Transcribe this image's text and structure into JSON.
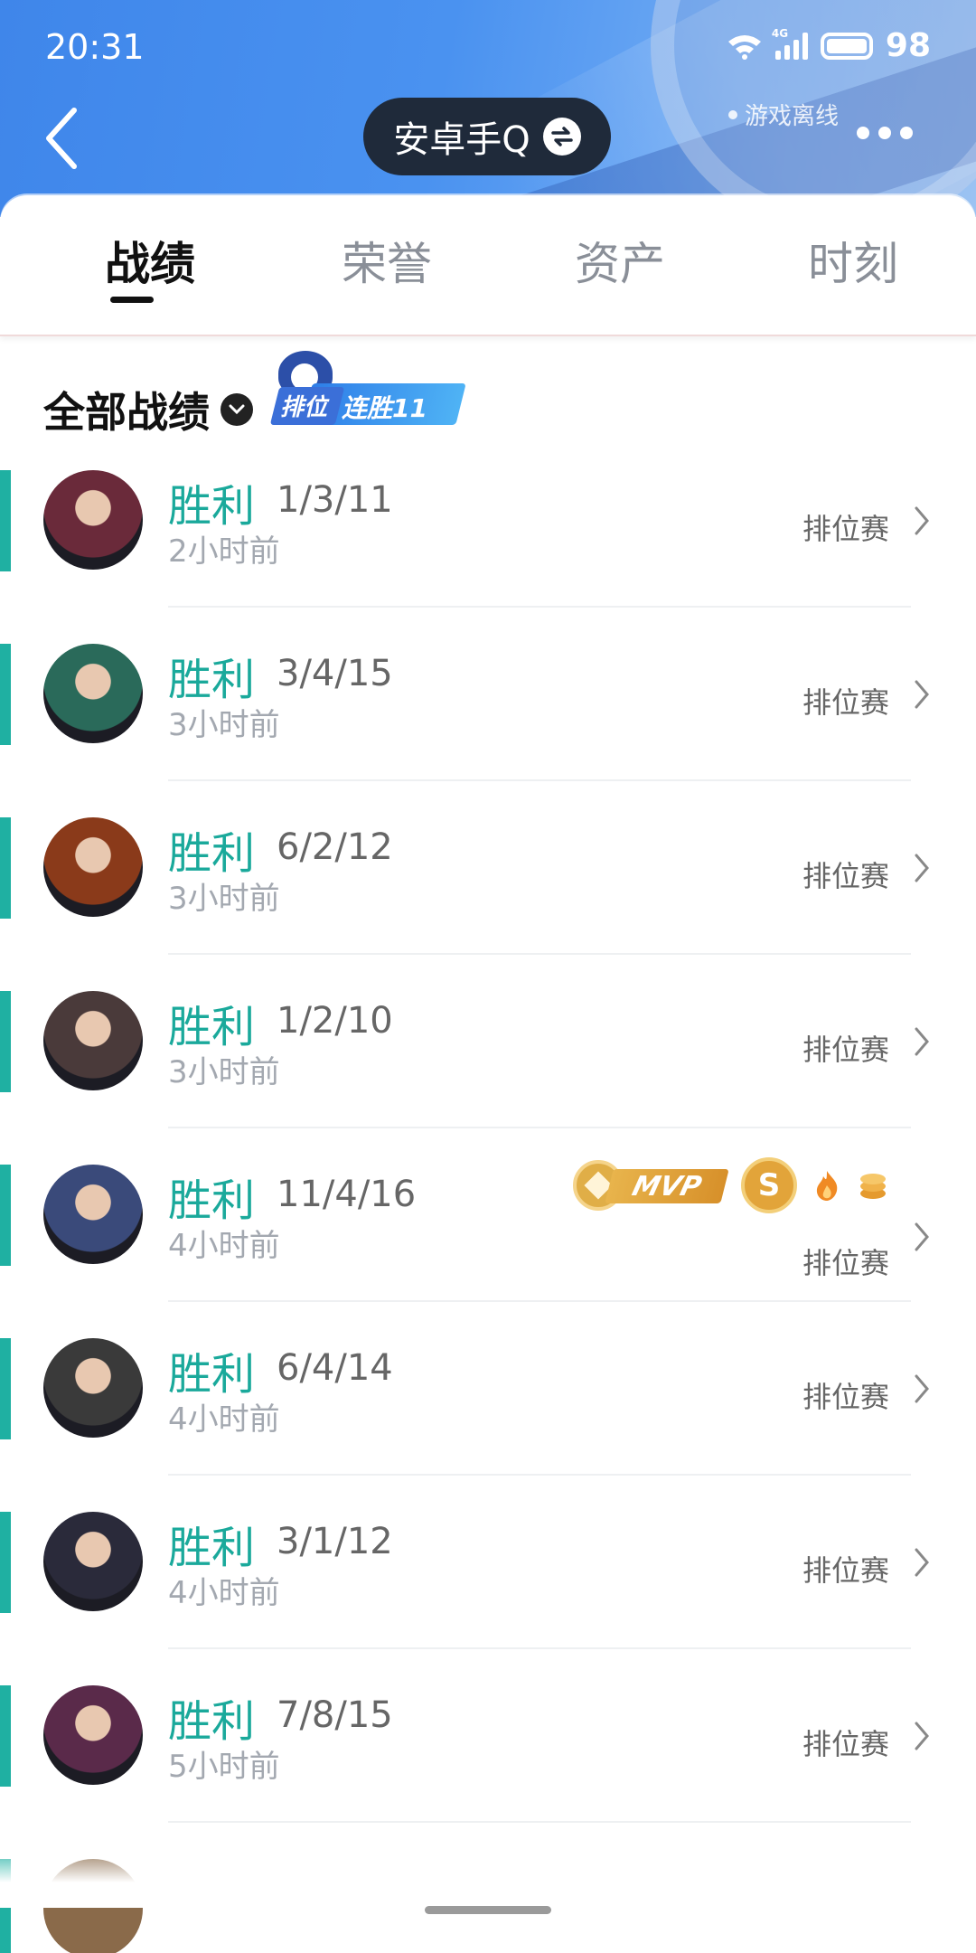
{
  "status_bar": {
    "time": "20:31",
    "battery": "98",
    "network": "4G"
  },
  "header": {
    "account_name": "安卓手Q",
    "offline_status": "游戏离线"
  },
  "tabs": [
    {
      "label": "战绩",
      "active": true
    },
    {
      "label": "荣誉",
      "active": false
    },
    {
      "label": "资产",
      "active": false
    },
    {
      "label": "时刻",
      "active": false
    }
  ],
  "section": {
    "title": "全部战绩",
    "streak_badge_a": "排位",
    "streak_badge_b": "连胜11"
  },
  "matches": [
    {
      "result": "胜利",
      "kda": "1/3/11",
      "ago": "2小时前",
      "mode": "排位赛",
      "avatar_color": "#6a2a3a"
    },
    {
      "result": "胜利",
      "kda": "3/4/15",
      "ago": "3小时前",
      "mode": "排位赛",
      "avatar_color": "#2a6a5a"
    },
    {
      "result": "胜利",
      "kda": "6/2/12",
      "ago": "3小时前",
      "mode": "排位赛",
      "avatar_color": "#8a3a1a"
    },
    {
      "result": "胜利",
      "kda": "1/2/10",
      "ago": "3小时前",
      "mode": "排位赛",
      "avatar_color": "#4a3a3a"
    },
    {
      "result": "胜利",
      "kda": "11/4/16",
      "ago": "4小时前",
      "mode": "排位赛",
      "avatar_color": "#3a4a7a",
      "mvp_label": "MVP",
      "s_label": "S"
    },
    {
      "result": "胜利",
      "kda": "6/4/14",
      "ago": "4小时前",
      "mode": "排位赛",
      "avatar_color": "#3a3a3a"
    },
    {
      "result": "胜利",
      "kda": "3/1/12",
      "ago": "4小时前",
      "mode": "排位赛",
      "avatar_color": "#2a2a3a"
    },
    {
      "result": "胜利",
      "kda": "7/8/15",
      "ago": "5小时前",
      "mode": "排位赛",
      "avatar_color": "#5a2a4a"
    }
  ],
  "colors": {
    "win": "#1aa99b",
    "accent_bar": "#1fb0a2",
    "header": "#4a92f0"
  }
}
